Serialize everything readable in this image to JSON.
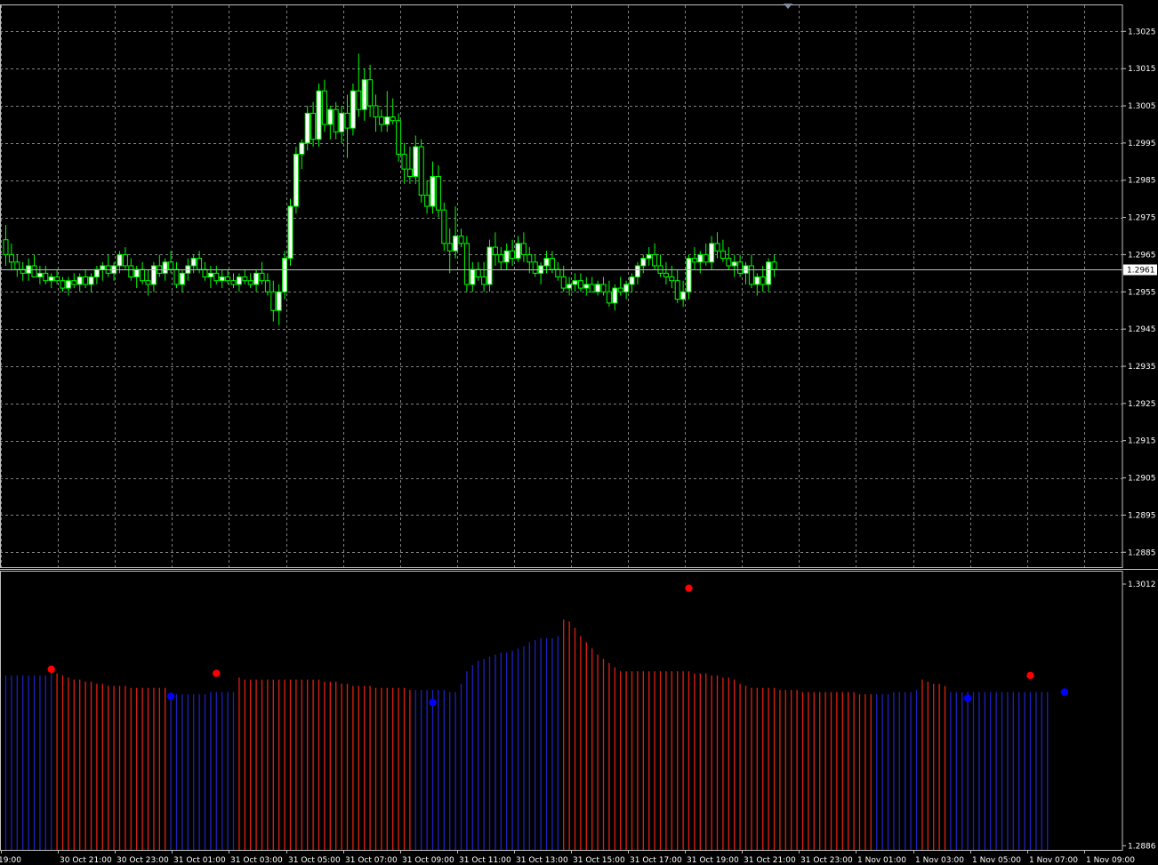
{
  "app": {
    "background": "#000000",
    "grid_color": "#808080",
    "axis_color": "#c0c0c0",
    "bull_color": "#00ff00",
    "bull_body": "#ffffff",
    "bear_color": "#00ff00",
    "bear_body": "#000000",
    "bid_line_color": "#c0c0c0",
    "indicator_up_color": "#2020c0",
    "indicator_down_color": "#e02010",
    "dot_high_color": "#ff0000",
    "dot_low_color": "#0000ff"
  },
  "scroll_marker": "triangle-down-icon",
  "chart_data": [
    {
      "type": "candlestick",
      "title": "",
      "y_tick_labels": [
        "1.3025",
        "1.3015",
        "1.3005",
        "1.2995",
        "1.2985",
        "1.2975",
        "1.2965",
        "1.2955",
        "1.2945",
        "1.2935",
        "1.2925",
        "1.2915",
        "1.2905",
        "1.2895",
        "1.2885"
      ],
      "ylim": [
        1.2881,
        1.3032
      ],
      "current_price_label": "1.2961",
      "current_price": 1.2961,
      "grid": true,
      "ohlc": [
        [
          1.2969,
          1.2973,
          1.2962,
          1.2965
        ],
        [
          1.2965,
          1.2968,
          1.2961,
          1.2963
        ],
        [
          1.2963,
          1.2965,
          1.2959,
          1.2961
        ],
        [
          1.2961,
          1.2963,
          1.2958,
          1.296
        ],
        [
          1.296,
          1.2964,
          1.2958,
          1.2962
        ],
        [
          1.2962,
          1.2965,
          1.2959,
          1.2959
        ],
        [
          1.2959,
          1.2962,
          1.2957,
          1.296
        ],
        [
          1.296,
          1.2962,
          1.2957,
          1.2958
        ],
        [
          1.2958,
          1.296,
          1.2956,
          1.2959
        ],
        [
          1.2959,
          1.2961,
          1.2957,
          1.2958
        ],
        [
          1.2958,
          1.2959,
          1.2955,
          1.2956
        ],
        [
          1.2956,
          1.2959,
          1.2954,
          1.2958
        ],
        [
          1.2958,
          1.296,
          1.2956,
          1.2957
        ],
        [
          1.2957,
          1.296,
          1.2955,
          1.2959
        ],
        [
          1.2959,
          1.2961,
          1.2956,
          1.2957
        ],
        [
          1.2957,
          1.296,
          1.2955,
          1.2959
        ],
        [
          1.2959,
          1.2962,
          1.2957,
          1.2961
        ],
        [
          1.2961,
          1.2963,
          1.2958,
          1.2962
        ],
        [
          1.2962,
          1.2965,
          1.2959,
          1.296
        ],
        [
          1.296,
          1.2963,
          1.2958,
          1.2962
        ],
        [
          1.2962,
          1.2966,
          1.296,
          1.2965
        ],
        [
          1.2965,
          1.2967,
          1.2961,
          1.2962
        ],
        [
          1.2962,
          1.2964,
          1.2958,
          1.2959
        ],
        [
          1.2959,
          1.2962,
          1.2956,
          1.2961
        ],
        [
          1.2961,
          1.2963,
          1.2957,
          1.2958
        ],
        [
          1.2958,
          1.2961,
          1.2954,
          1.2957
        ],
        [
          1.2957,
          1.2963,
          1.2955,
          1.2962
        ],
        [
          1.2962,
          1.2965,
          1.2959,
          1.296
        ],
        [
          1.296,
          1.2964,
          1.2958,
          1.2963
        ],
        [
          1.2963,
          1.2966,
          1.296,
          1.2961
        ],
        [
          1.2961,
          1.2963,
          1.2956,
          1.2957
        ],
        [
          1.2957,
          1.2961,
          1.2955,
          1.296
        ],
        [
          1.296,
          1.2964,
          1.2958,
          1.2962
        ],
        [
          1.2962,
          1.2965,
          1.296,
          1.2964
        ],
        [
          1.2964,
          1.2966,
          1.296,
          1.2961
        ],
        [
          1.2961,
          1.2963,
          1.2958,
          1.2959
        ],
        [
          1.2959,
          1.2962,
          1.2956,
          1.296
        ],
        [
          1.296,
          1.2962,
          1.2957,
          1.2958
        ],
        [
          1.2958,
          1.2961,
          1.2956,
          1.2959
        ],
        [
          1.2959,
          1.2961,
          1.2957,
          1.2958
        ],
        [
          1.2958,
          1.296,
          1.2956,
          1.2957
        ],
        [
          1.2957,
          1.296,
          1.2955,
          1.2959
        ],
        [
          1.2959,
          1.2961,
          1.2957,
          1.2958
        ],
        [
          1.2958,
          1.296,
          1.2956,
          1.2957
        ],
        [
          1.2957,
          1.2961,
          1.2955,
          1.296
        ],
        [
          1.296,
          1.2963,
          1.2957,
          1.2958
        ],
        [
          1.2958,
          1.296,
          1.2954,
          1.2955
        ],
        [
          1.2955,
          1.2958,
          1.2947,
          1.295
        ],
        [
          1.295,
          1.2957,
          1.2946,
          1.2955
        ],
        [
          1.2955,
          1.2966,
          1.2953,
          1.2964
        ],
        [
          1.2964,
          1.298,
          1.2962,
          1.2978
        ],
        [
          1.2978,
          1.2994,
          1.2976,
          1.2992
        ],
        [
          1.2992,
          1.2996,
          1.2988,
          1.2995
        ],
        [
          1.2995,
          1.3005,
          1.2993,
          1.3003
        ],
        [
          1.3003,
          1.3006,
          1.2994,
          1.2996
        ],
        [
          1.2996,
          1.3011,
          1.2994,
          1.3009
        ],
        [
          1.3009,
          1.3012,
          1.2998,
          1.3
        ],
        [
          1.3,
          1.3005,
          1.2996,
          1.3004
        ],
        [
          1.3004,
          1.3006,
          1.2996,
          1.2998
        ],
        [
          1.2998,
          1.3005,
          1.2995,
          1.3003
        ],
        [
          1.3003,
          1.3008,
          1.2991,
          1.2999
        ],
        [
          1.2999,
          1.3011,
          1.2997,
          1.3009
        ],
        [
          1.3009,
          1.3019,
          1.3002,
          1.3004
        ],
        [
          1.3004,
          1.3015,
          1.3001,
          1.3012
        ],
        [
          1.3012,
          1.3016,
          1.3002,
          1.3005
        ],
        [
          1.3005,
          1.3008,
          1.2998,
          1.3002
        ],
        [
          1.3002,
          1.3004,
          1.2998,
          1.3
        ],
        [
          1.3,
          1.3009,
          1.2998,
          1.3002
        ],
        [
          1.3002,
          1.3007,
          1.3,
          1.3001
        ],
        [
          1.3001,
          1.3003,
          1.299,
          1.2992
        ],
        [
          1.2992,
          1.2995,
          1.2984,
          1.2988
        ],
        [
          1.2988,
          1.2994,
          1.2984,
          1.2986
        ],
        [
          1.2986,
          1.2997,
          1.2984,
          1.2994
        ],
        [
          1.2994,
          1.2996,
          1.2979,
          1.2981
        ],
        [
          1.2981,
          1.2985,
          1.2976,
          1.2978
        ],
        [
          1.2978,
          1.299,
          1.2976,
          1.2986
        ],
        [
          1.2986,
          1.2989,
          1.2975,
          1.2977
        ],
        [
          1.2977,
          1.2979,
          1.2966,
          1.2968
        ],
        [
          1.2968,
          1.2972,
          1.296,
          1.2966
        ],
        [
          1.2966,
          1.2978,
          1.2964,
          1.297
        ],
        [
          1.297,
          1.2972,
          1.2967,
          1.2968
        ],
        [
          1.2968,
          1.297,
          1.2955,
          1.2957
        ],
        [
          1.2957,
          1.2963,
          1.2955,
          1.2961
        ],
        [
          1.2961,
          1.2963,
          1.2958,
          1.2959
        ],
        [
          1.2959,
          1.2963,
          1.2955,
          1.2957
        ],
        [
          1.2957,
          1.2969,
          1.2955,
          1.2967
        ],
        [
          1.2967,
          1.2971,
          1.2962,
          1.2965
        ],
        [
          1.2965,
          1.2967,
          1.2961,
          1.2963
        ],
        [
          1.2963,
          1.2968,
          1.2961,
          1.2966
        ],
        [
          1.2966,
          1.2969,
          1.2962,
          1.2964
        ],
        [
          1.2964,
          1.297,
          1.2963,
          1.2968
        ],
        [
          1.2968,
          1.2971,
          1.2963,
          1.2965
        ],
        [
          1.2965,
          1.2967,
          1.296,
          1.2963
        ],
        [
          1.2963,
          1.2965,
          1.2959,
          1.296
        ],
        [
          1.296,
          1.2963,
          1.2957,
          1.2962
        ],
        [
          1.2962,
          1.2966,
          1.296,
          1.2964
        ],
        [
          1.2964,
          1.2966,
          1.296,
          1.2961
        ],
        [
          1.2961,
          1.2963,
          1.2958,
          1.2959
        ],
        [
          1.2959,
          1.2962,
          1.2955,
          1.2956
        ],
        [
          1.2956,
          1.2959,
          1.2954,
          1.2957
        ],
        [
          1.2957,
          1.296,
          1.2955,
          1.2958
        ],
        [
          1.2958,
          1.296,
          1.2955,
          1.2956
        ],
        [
          1.2956,
          1.2959,
          1.2954,
          1.2957
        ],
        [
          1.2957,
          1.2959,
          1.2955,
          1.2955
        ],
        [
          1.2955,
          1.2958,
          1.2954,
          1.2957
        ],
        [
          1.2957,
          1.2959,
          1.2954,
          1.2955
        ],
        [
          1.2955,
          1.2958,
          1.2951,
          1.2952
        ],
        [
          1.2952,
          1.2957,
          1.295,
          1.2956
        ],
        [
          1.2956,
          1.2959,
          1.2954,
          1.2955
        ],
        [
          1.2955,
          1.2958,
          1.2953,
          1.2957
        ],
        [
          1.2957,
          1.296,
          1.2955,
          1.2959
        ],
        [
          1.2959,
          1.2963,
          1.2957,
          1.2962
        ],
        [
          1.2962,
          1.2965,
          1.296,
          1.2964
        ],
        [
          1.2964,
          1.2967,
          1.2962,
          1.2965
        ],
        [
          1.2965,
          1.2968,
          1.2961,
          1.2962
        ],
        [
          1.2962,
          1.2965,
          1.2959,
          1.296
        ],
        [
          1.296,
          1.2963,
          1.2957,
          1.2959
        ],
        [
          1.2959,
          1.2962,
          1.2956,
          1.2958
        ],
        [
          1.2958,
          1.2961,
          1.2952,
          1.2953
        ],
        [
          1.2953,
          1.2958,
          1.2951,
          1.2955
        ],
        [
          1.2955,
          1.2965,
          1.2953,
          1.2964
        ],
        [
          1.2964,
          1.2967,
          1.2961,
          1.2963
        ],
        [
          1.2963,
          1.2966,
          1.296,
          1.2965
        ],
        [
          1.2965,
          1.2968,
          1.2962,
          1.2963
        ],
        [
          1.2963,
          1.297,
          1.2961,
          1.2968
        ],
        [
          1.2968,
          1.2971,
          1.2964,
          1.2966
        ],
        [
          1.2966,
          1.2969,
          1.2963,
          1.2964
        ],
        [
          1.2964,
          1.2967,
          1.2961,
          1.2962
        ],
        [
          1.2962,
          1.2965,
          1.2959,
          1.2963
        ],
        [
          1.2963,
          1.2965,
          1.2959,
          1.296
        ],
        [
          1.296,
          1.2963,
          1.2957,
          1.2962
        ],
        [
          1.2962,
          1.2965,
          1.2956,
          1.2957
        ],
        [
          1.2957,
          1.296,
          1.2954,
          1.2959
        ],
        [
          1.2959,
          1.2962,
          1.2955,
          1.2957
        ],
        [
          1.2957,
          1.2964,
          1.2955,
          1.2963
        ],
        [
          1.2963,
          1.2965,
          1.2959,
          1.2961
        ]
      ]
    },
    {
      "type": "bar",
      "title": "",
      "y_tick_labels": [
        "1.3012",
        "1.2886"
      ],
      "ylim": [
        1.2884,
        1.3018
      ],
      "x_tick_labels": [
        "19:00",
        "30 Oct 21:00",
        "30 Oct 23:00",
        "31 Oct 01:00",
        "31 Oct 03:00",
        "31 Oct 05:00",
        "31 Oct 07:00",
        "31 Oct 09:00",
        "31 Oct 11:00",
        "31 Oct 13:00",
        "31 Oct 15:00",
        "31 Oct 17:00",
        "31 Oct 19:00",
        "31 Oct 21:00",
        "31 Oct 23:00",
        "1 Nov 01:00",
        "1 Nov 03:00",
        "1 Nov 05:00",
        "1 Nov 07:00",
        "1 Nov 09:00"
      ],
      "segments": [
        {
          "dir": "up",
          "bars": 9,
          "values": [
            1.2968,
            1.2968,
            1.2968,
            1.2968,
            1.2968,
            1.2968,
            1.2968,
            1.2968,
            1.2969
          ]
        },
        {
          "dir": "down",
          "bars": 20,
          "values": [
            1.2969,
            1.2968,
            1.2967,
            1.2966,
            1.2966,
            1.2965,
            1.2965,
            1.2964,
            1.2964,
            1.2963,
            1.2963,
            1.2963,
            1.2963,
            1.2962,
            1.2962,
            1.2962,
            1.2962,
            1.2962,
            1.2962,
            1.2962
          ]
        },
        {
          "dir": "up",
          "bars": 12,
          "values": [
            1.2959,
            1.2959,
            1.2959,
            1.2959,
            1.2959,
            1.2959,
            1.2959,
            1.296,
            1.296,
            1.296,
            1.296,
            1.296
          ]
        },
        {
          "dir": "down",
          "bars": 31,
          "values": [
            1.2967,
            1.2966,
            1.2966,
            1.2966,
            1.2966,
            1.2966,
            1.2966,
            1.2966,
            1.2966,
            1.2966,
            1.2966,
            1.2966,
            1.2966,
            1.2966,
            1.2966,
            1.2965,
            1.2965,
            1.2965,
            1.2964,
            1.2964,
            1.2963,
            1.2963,
            1.2963,
            1.2963,
            1.2962,
            1.2962,
            1.2962,
            1.2962,
            1.2962,
            1.2962,
            1.2961
          ]
        },
        {
          "dir": "up",
          "bars": 26,
          "values": [
            1.2961,
            1.2961,
            1.2961,
            1.2961,
            1.2961,
            1.2961,
            1.296,
            1.296,
            1.2964,
            1.297,
            1.2973,
            1.2975,
            1.2976,
            1.2977,
            1.2978,
            1.2979,
            1.2979,
            1.298,
            1.2981,
            1.2982,
            1.2984,
            1.2985,
            1.2986,
            1.2986,
            1.2986,
            1.2987
          ]
        },
        {
          "dir": "down",
          "bars": 55,
          "values": [
            1.2995,
            1.2994,
            1.2991,
            1.2987,
            1.2984,
            1.2981,
            1.2978,
            1.2976,
            1.2974,
            1.2972,
            1.297,
            1.297,
            1.297,
            1.297,
            1.297,
            1.297,
            1.297,
            1.297,
            1.297,
            1.297,
            1.297,
            1.297,
            1.297,
            1.2969,
            1.2969,
            1.2969,
            1.2968,
            1.2968,
            1.2967,
            1.2967,
            1.2966,
            1.2964,
            1.2963,
            1.2962,
            1.2962,
            1.2962,
            1.2962,
            1.2962,
            1.2961,
            1.2961,
            1.2961,
            1.2961,
            1.296,
            1.296,
            1.296,
            1.296,
            1.296,
            1.296,
            1.296,
            1.296,
            1.296,
            1.296,
            1.2959,
            1.2959,
            1.2959
          ]
        },
        {
          "dir": "up",
          "bars": 8,
          "values": [
            1.2959,
            1.2959,
            1.2959,
            1.296,
            1.296,
            1.296,
            1.296,
            1.2961
          ]
        },
        {
          "dir": "down",
          "bars": 5,
          "values": [
            1.2966,
            1.2965,
            1.2964,
            1.2964,
            1.2963
          ]
        },
        {
          "dir": "up",
          "bars": 18,
          "values": [
            1.296,
            1.296,
            1.296,
            1.296,
            1.296,
            1.296,
            1.296,
            1.296,
            1.296,
            1.296,
            1.296,
            1.296,
            1.296,
            1.296,
            1.296,
            1.296,
            1.296,
            1.296
          ]
        }
      ],
      "dots": [
        {
          "bar": 8,
          "value": 1.2971,
          "kind": "high"
        },
        {
          "bar": 29,
          "value": 1.2958,
          "kind": "low"
        },
        {
          "bar": 37,
          "value": 1.2969,
          "kind": "high"
        },
        {
          "bar": 75,
          "value": 1.2955,
          "kind": "low"
        },
        {
          "bar": 120,
          "value": 1.301,
          "kind": "high"
        },
        {
          "bar": 169,
          "value": 1.2957,
          "kind": "low"
        },
        {
          "bar": 180,
          "value": 1.2968,
          "kind": "high"
        },
        {
          "bar": 186,
          "value": 1.296,
          "kind": "low"
        }
      ]
    }
  ]
}
